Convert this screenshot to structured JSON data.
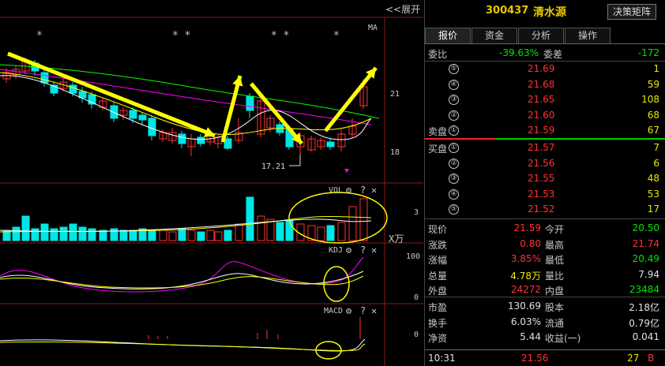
{
  "chart": {
    "expand_label": "<<展开",
    "ma_label": "MA",
    "price_ticks": [
      "21",
      "18"
    ],
    "low_annotation": "17.21",
    "star_marks": [
      "*",
      "* *",
      "* *",
      "*"
    ],
    "vol_label": "VOL",
    "vol_tick": "3",
    "vol_unit": "X万",
    "kdj_label": "KDJ",
    "kdj_ticks": [
      "100",
      "0"
    ],
    "macd_label": "MACD",
    "macd_tick": "0",
    "gear_icon": "⚙",
    "help_icon": "?",
    "close_icon": "✕"
  },
  "chart_data": {
    "type": "candlestick",
    "y_ticks": [
      21,
      18
    ],
    "low_marker": 17.21,
    "volume_ticks": [
      3
    ],
    "kdj_ticks": [
      100,
      0
    ],
    "macd_ticks": [
      0
    ]
  },
  "header": {
    "code": "300437",
    "name": "清水源",
    "decision_button": "决策矩阵"
  },
  "tabs": [
    "报价",
    "资金",
    "分析",
    "操作"
  ],
  "order_book": {
    "webi_label": "委比",
    "webi_value": "-39.63%",
    "weicha_label": "委差",
    "weicha_value": "-172",
    "sell_label": "卖盘",
    "buy_label": "买盘",
    "asks": [
      {
        "level": "⑤",
        "price": "21.69",
        "vol": "1"
      },
      {
        "level": "④",
        "price": "21.68",
        "vol": "59"
      },
      {
        "level": "③",
        "price": "21.65",
        "vol": "108"
      },
      {
        "level": "②",
        "price": "21.60",
        "vol": "68"
      },
      {
        "level": "①",
        "price": "21.59",
        "vol": "67"
      }
    ],
    "bids": [
      {
        "level": "①",
        "price": "21.57",
        "vol": "7"
      },
      {
        "level": "②",
        "price": "21.56",
        "vol": "6"
      },
      {
        "level": "③",
        "price": "21.55",
        "vol": "48"
      },
      {
        "level": "④",
        "price": "21.53",
        "vol": "53"
      },
      {
        "level": "⑤",
        "price": "21.52",
        "vol": "17"
      }
    ]
  },
  "quote": [
    {
      "l1": "现价",
      "v1": "21.59",
      "c1": "red",
      "l2": "今开",
      "v2": "20.50",
      "c2": "green"
    },
    {
      "l1": "涨跌",
      "v1": "0.80",
      "c1": "red",
      "l2": "最高",
      "v2": "21.74",
      "c2": "red"
    },
    {
      "l1": "涨幅",
      "v1": "3.85%",
      "c1": "red",
      "l2": "最低",
      "v2": "20.49",
      "c2": "green"
    },
    {
      "l1": "总量",
      "v1": "4.78万",
      "c1": "yellow",
      "l2": "量比",
      "v2": "7.94",
      "c2": "white"
    },
    {
      "l1": "外盘",
      "v1": "24272",
      "c1": "red",
      "l2": "内盘",
      "v2": "23484",
      "c2": "green"
    }
  ],
  "fundamentals": [
    {
      "l1": "市盈",
      "v1": "130.69",
      "l2": "股本",
      "v2": "2.18亿"
    },
    {
      "l1": "换手",
      "v1": "6.03%",
      "l2": "流通",
      "v2": "0.79亿"
    },
    {
      "l1": "净资",
      "v1": "5.44",
      "l2": "收益(一)",
      "v2": "0.041"
    }
  ],
  "tick": {
    "time": "10:31",
    "price": "21.56",
    "vol": "27",
    "side": "B"
  },
  "colors": {
    "up": "#ff3232",
    "down": "#00e6e6",
    "arrow": "#ffff00",
    "ma5": "#ffffff",
    "ma10": "#ffff00",
    "ma20": "#ff00ff",
    "ma60": "#00ff00"
  }
}
